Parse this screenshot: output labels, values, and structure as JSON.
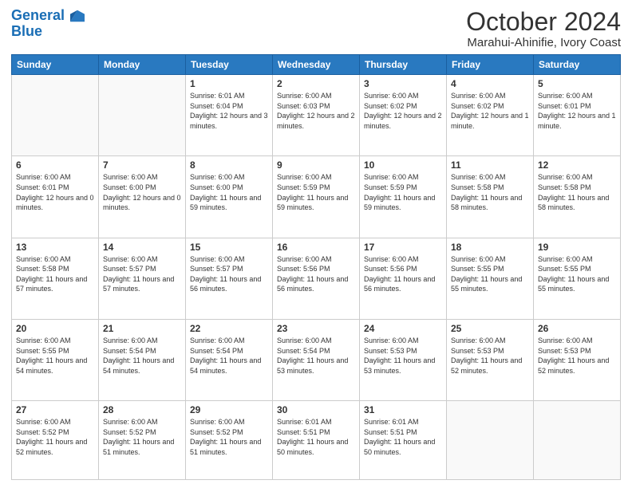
{
  "header": {
    "logo_line1": "General",
    "logo_line2": "Blue",
    "title": "October 2024",
    "subtitle": "Marahui-Ahinifie, Ivory Coast"
  },
  "weekdays": [
    "Sunday",
    "Monday",
    "Tuesday",
    "Wednesday",
    "Thursday",
    "Friday",
    "Saturday"
  ],
  "weeks": [
    [
      {
        "day": "",
        "sunrise": "",
        "sunset": "",
        "daylight": ""
      },
      {
        "day": "",
        "sunrise": "",
        "sunset": "",
        "daylight": ""
      },
      {
        "day": "1",
        "sunrise": "Sunrise: 6:01 AM",
        "sunset": "Sunset: 6:04 PM",
        "daylight": "Daylight: 12 hours and 3 minutes."
      },
      {
        "day": "2",
        "sunrise": "Sunrise: 6:00 AM",
        "sunset": "Sunset: 6:03 PM",
        "daylight": "Daylight: 12 hours and 2 minutes."
      },
      {
        "day": "3",
        "sunrise": "Sunrise: 6:00 AM",
        "sunset": "Sunset: 6:02 PM",
        "daylight": "Daylight: 12 hours and 2 minutes."
      },
      {
        "day": "4",
        "sunrise": "Sunrise: 6:00 AM",
        "sunset": "Sunset: 6:02 PM",
        "daylight": "Daylight: 12 hours and 1 minute."
      },
      {
        "day": "5",
        "sunrise": "Sunrise: 6:00 AM",
        "sunset": "Sunset: 6:01 PM",
        "daylight": "Daylight: 12 hours and 1 minute."
      }
    ],
    [
      {
        "day": "6",
        "sunrise": "Sunrise: 6:00 AM",
        "sunset": "Sunset: 6:01 PM",
        "daylight": "Daylight: 12 hours and 0 minutes."
      },
      {
        "day": "7",
        "sunrise": "Sunrise: 6:00 AM",
        "sunset": "Sunset: 6:00 PM",
        "daylight": "Daylight: 12 hours and 0 minutes."
      },
      {
        "day": "8",
        "sunrise": "Sunrise: 6:00 AM",
        "sunset": "Sunset: 6:00 PM",
        "daylight": "Daylight: 11 hours and 59 minutes."
      },
      {
        "day": "9",
        "sunrise": "Sunrise: 6:00 AM",
        "sunset": "Sunset: 5:59 PM",
        "daylight": "Daylight: 11 hours and 59 minutes."
      },
      {
        "day": "10",
        "sunrise": "Sunrise: 6:00 AM",
        "sunset": "Sunset: 5:59 PM",
        "daylight": "Daylight: 11 hours and 59 minutes."
      },
      {
        "day": "11",
        "sunrise": "Sunrise: 6:00 AM",
        "sunset": "Sunset: 5:58 PM",
        "daylight": "Daylight: 11 hours and 58 minutes."
      },
      {
        "day": "12",
        "sunrise": "Sunrise: 6:00 AM",
        "sunset": "Sunset: 5:58 PM",
        "daylight": "Daylight: 11 hours and 58 minutes."
      }
    ],
    [
      {
        "day": "13",
        "sunrise": "Sunrise: 6:00 AM",
        "sunset": "Sunset: 5:58 PM",
        "daylight": "Daylight: 11 hours and 57 minutes."
      },
      {
        "day": "14",
        "sunrise": "Sunrise: 6:00 AM",
        "sunset": "Sunset: 5:57 PM",
        "daylight": "Daylight: 11 hours and 57 minutes."
      },
      {
        "day": "15",
        "sunrise": "Sunrise: 6:00 AM",
        "sunset": "Sunset: 5:57 PM",
        "daylight": "Daylight: 11 hours and 56 minutes."
      },
      {
        "day": "16",
        "sunrise": "Sunrise: 6:00 AM",
        "sunset": "Sunset: 5:56 PM",
        "daylight": "Daylight: 11 hours and 56 minutes."
      },
      {
        "day": "17",
        "sunrise": "Sunrise: 6:00 AM",
        "sunset": "Sunset: 5:56 PM",
        "daylight": "Daylight: 11 hours and 56 minutes."
      },
      {
        "day": "18",
        "sunrise": "Sunrise: 6:00 AM",
        "sunset": "Sunset: 5:55 PM",
        "daylight": "Daylight: 11 hours and 55 minutes."
      },
      {
        "day": "19",
        "sunrise": "Sunrise: 6:00 AM",
        "sunset": "Sunset: 5:55 PM",
        "daylight": "Daylight: 11 hours and 55 minutes."
      }
    ],
    [
      {
        "day": "20",
        "sunrise": "Sunrise: 6:00 AM",
        "sunset": "Sunset: 5:55 PM",
        "daylight": "Daylight: 11 hours and 54 minutes."
      },
      {
        "day": "21",
        "sunrise": "Sunrise: 6:00 AM",
        "sunset": "Sunset: 5:54 PM",
        "daylight": "Daylight: 11 hours and 54 minutes."
      },
      {
        "day": "22",
        "sunrise": "Sunrise: 6:00 AM",
        "sunset": "Sunset: 5:54 PM",
        "daylight": "Daylight: 11 hours and 54 minutes."
      },
      {
        "day": "23",
        "sunrise": "Sunrise: 6:00 AM",
        "sunset": "Sunset: 5:54 PM",
        "daylight": "Daylight: 11 hours and 53 minutes."
      },
      {
        "day": "24",
        "sunrise": "Sunrise: 6:00 AM",
        "sunset": "Sunset: 5:53 PM",
        "daylight": "Daylight: 11 hours and 53 minutes."
      },
      {
        "day": "25",
        "sunrise": "Sunrise: 6:00 AM",
        "sunset": "Sunset: 5:53 PM",
        "daylight": "Daylight: 11 hours and 52 minutes."
      },
      {
        "day": "26",
        "sunrise": "Sunrise: 6:00 AM",
        "sunset": "Sunset: 5:53 PM",
        "daylight": "Daylight: 11 hours and 52 minutes."
      }
    ],
    [
      {
        "day": "27",
        "sunrise": "Sunrise: 6:00 AM",
        "sunset": "Sunset: 5:52 PM",
        "daylight": "Daylight: 11 hours and 52 minutes."
      },
      {
        "day": "28",
        "sunrise": "Sunrise: 6:00 AM",
        "sunset": "Sunset: 5:52 PM",
        "daylight": "Daylight: 11 hours and 51 minutes."
      },
      {
        "day": "29",
        "sunrise": "Sunrise: 6:00 AM",
        "sunset": "Sunset: 5:52 PM",
        "daylight": "Daylight: 11 hours and 51 minutes."
      },
      {
        "day": "30",
        "sunrise": "Sunrise: 6:01 AM",
        "sunset": "Sunset: 5:51 PM",
        "daylight": "Daylight: 11 hours and 50 minutes."
      },
      {
        "day": "31",
        "sunrise": "Sunrise: 6:01 AM",
        "sunset": "Sunset: 5:51 PM",
        "daylight": "Daylight: 11 hours and 50 minutes."
      },
      {
        "day": "",
        "sunrise": "",
        "sunset": "",
        "daylight": ""
      },
      {
        "day": "",
        "sunrise": "",
        "sunset": "",
        "daylight": ""
      }
    ]
  ]
}
